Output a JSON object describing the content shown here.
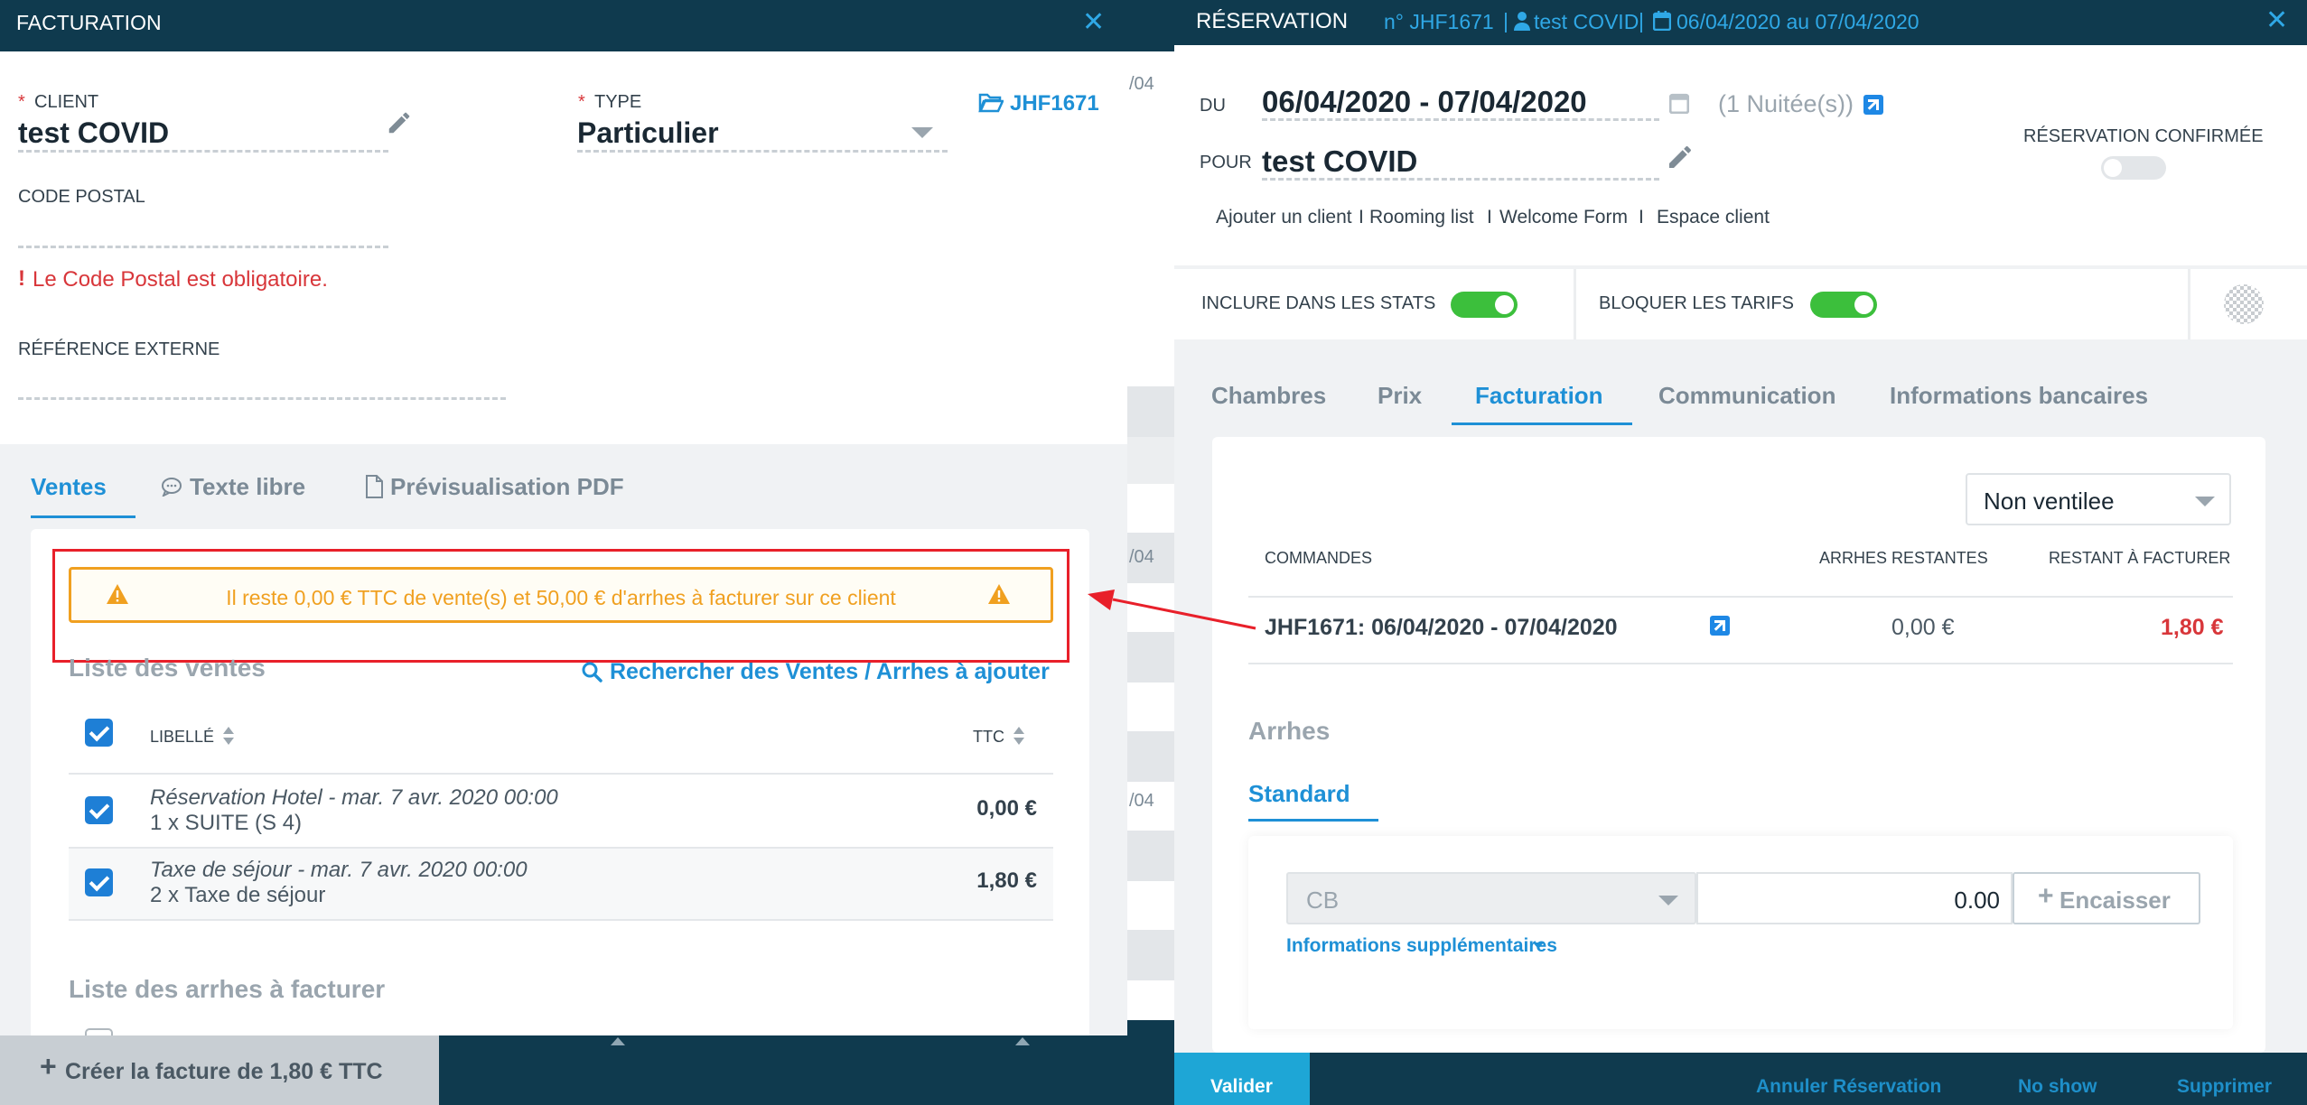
{
  "left": {
    "header": {
      "title": "FACTURATION",
      "close": "✕"
    },
    "client": {
      "required": "*",
      "label": "CLIENT",
      "value": "test COVID"
    },
    "type": {
      "required": "*",
      "label": "TYPE",
      "value": "Particulier"
    },
    "ref": "JHF1671",
    "postal": {
      "label": "CODE POSTAL",
      "error_mark": "!",
      "error": "Le Code Postal est obligatoire."
    },
    "external_ref": {
      "label": "RÉFÉRENCE EXTERNE"
    },
    "tabs": [
      {
        "label": "Ventes",
        "active": true
      },
      {
        "label": "Texte libre",
        "active": false
      },
      {
        "label": "Prévisualisation PDF",
        "active": false
      }
    ],
    "warning": "Il reste 0,00 € TTC de vente(s) et 50,00 € d'arrhes à facturer sur ce client",
    "sales": {
      "title": "Liste des ventes",
      "search_link": "Rechercher des Ventes / Arrhes à ajouter",
      "columns": {
        "label": "LIBELLÉ",
        "ttc": "TTC"
      },
      "rows": [
        {
          "line1": "Réservation Hotel - mar. 7 avr. 2020 00:00",
          "line2": "1 x SUITE (S 4)",
          "amount": "0,00 €"
        },
        {
          "line1": "Taxe de séjour - mar. 7 avr. 2020 00:00",
          "line2": "2 x Taxe de séjour",
          "amount": "1,80 €"
        }
      ]
    },
    "arrhes_title": "Liste des arrhes à facturer",
    "create_button": "Créer la facture de 1,80 € TTC"
  },
  "middle": {
    "dates": [
      "/04",
      "/04",
      "/04"
    ]
  },
  "right": {
    "header": {
      "title": "RÉSERVATION",
      "number": "n° JHF1671",
      "client": "test COVID",
      "dates": "06/04/2020 au 07/04/2020",
      "close": "✕"
    },
    "du_label": "DU",
    "dates_value": "06/04/2020 - 07/04/2020",
    "nights": "(1 Nuitée(s))",
    "pour_label": "POUR",
    "client_value": "test COVID",
    "confirmed_label": "RÉSERVATION CONFIRMÉE",
    "links": [
      "Ajouter un client",
      "Rooming list",
      "Welcome Form",
      "Espace client"
    ],
    "stats_label": "INCLURE DANS LES STATS",
    "tarifs_label": "BLOQUER LES TARIFS",
    "tabs": [
      {
        "label": "Chambres",
        "active": false
      },
      {
        "label": "Prix",
        "active": false
      },
      {
        "label": "Facturation",
        "active": true
      },
      {
        "label": "Communication",
        "active": false
      },
      {
        "label": "Informations bancaires",
        "active": false
      }
    ],
    "ventilation": "Non ventilee",
    "orders": {
      "columns": {
        "commandes": "COMMANDES",
        "arrhes": "ARRHES RESTANTES",
        "restant": "RESTANT À FACTURER"
      },
      "row": {
        "label": "JHF1671: 06/04/2020 - 07/04/2020",
        "arrhes": "0,00 €",
        "restant": "1,80 €"
      }
    },
    "arrhes_title": "Arrhes",
    "arrhes_tab": "Standard",
    "payment": {
      "method": "CB",
      "amount": "0.00",
      "button": "Encaisser",
      "more": "Informations supplémentaires"
    },
    "footer": {
      "validate": "Valider",
      "cancel": "Annuler Réservation",
      "noshow": "No show",
      "delete": "Supprimer"
    }
  },
  "colors": {
    "navy": "#0f3a4e",
    "accent": "#1e90d6",
    "warning": "#f0a020",
    "error": "#d8363a",
    "toggle": "#3cbf3c"
  }
}
